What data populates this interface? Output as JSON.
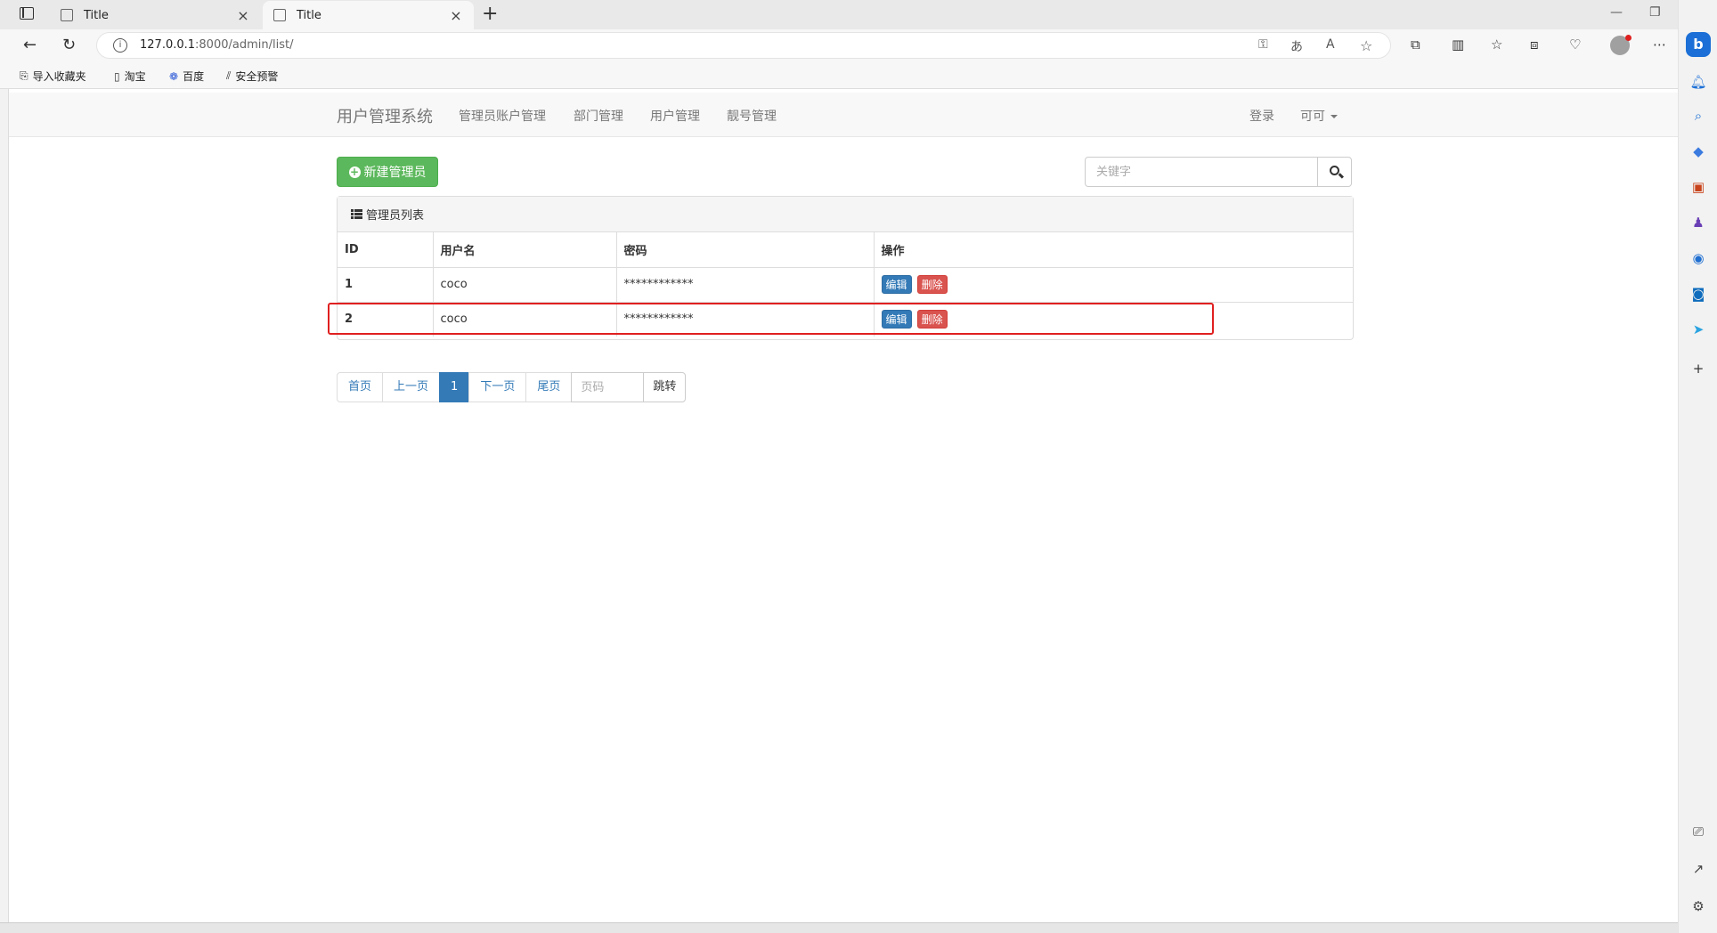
{
  "browser": {
    "tabs": [
      {
        "title": "Title",
        "active": false
      },
      {
        "title": "Title",
        "active": true
      }
    ],
    "url_host": "127.0.0.1",
    "url_rest": ":8000/admin/list/",
    "bookmarks": [
      {
        "label": "导入收藏夹",
        "icon": "import-icon"
      },
      {
        "label": "淘宝",
        "icon": "page-icon"
      },
      {
        "label": "百度",
        "icon": "baidu-paw-icon"
      },
      {
        "label": "安全预警",
        "icon": "warning-stripes-icon"
      }
    ]
  },
  "navbar": {
    "brand": "用户管理系统",
    "links": [
      "管理员账户管理",
      "部门管理",
      "用户管理",
      "靓号管理"
    ],
    "login": "登录",
    "user": "可可"
  },
  "toolbar": {
    "new_button": "新建管理员",
    "search_placeholder": "关键字"
  },
  "panel": {
    "title": "管理员列表",
    "columns": [
      "ID",
      "用户名",
      "密码",
      "操作"
    ],
    "rows": [
      {
        "id": "1",
        "username": "coco",
        "password": "************",
        "edit": "编辑",
        "delete": "删除"
      },
      {
        "id": "2",
        "username": "coco",
        "password": "************",
        "edit": "编辑",
        "delete": "删除"
      }
    ]
  },
  "pagination": {
    "first": "首页",
    "prev": "上一页",
    "current": "1",
    "next": "下一页",
    "last": "尾页",
    "page_placeholder": "页码",
    "go": "跳转"
  },
  "colors": {
    "success": "#5cb85c",
    "primary": "#337ab7",
    "danger": "#d9534f",
    "highlight": "#e02020"
  }
}
